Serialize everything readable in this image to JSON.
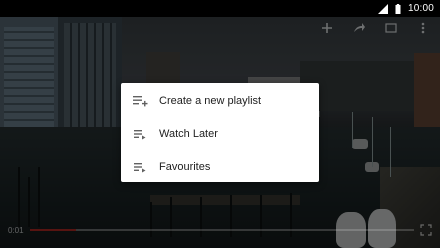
{
  "status_bar": {
    "time": "10:00",
    "icons": [
      "cellular-signal-icon",
      "battery-icon"
    ]
  },
  "player": {
    "top_controls": [
      "add-to-playlist-icon",
      "share-icon",
      "cast-icon",
      "more-vert-icon"
    ],
    "current_time": "0:01",
    "progress_fraction": 0.12
  },
  "menu": {
    "items": [
      {
        "label": "Create a new playlist",
        "icon": "playlist-add-icon"
      },
      {
        "label": "Watch Later",
        "icon": "playlist-play-icon"
      },
      {
        "label": "Favourites",
        "icon": "playlist-play-icon"
      }
    ]
  },
  "colors": {
    "menu_background": "#ffffff",
    "menu_text": "#212121",
    "icon": "#616161",
    "progress_played": "#e62117"
  }
}
